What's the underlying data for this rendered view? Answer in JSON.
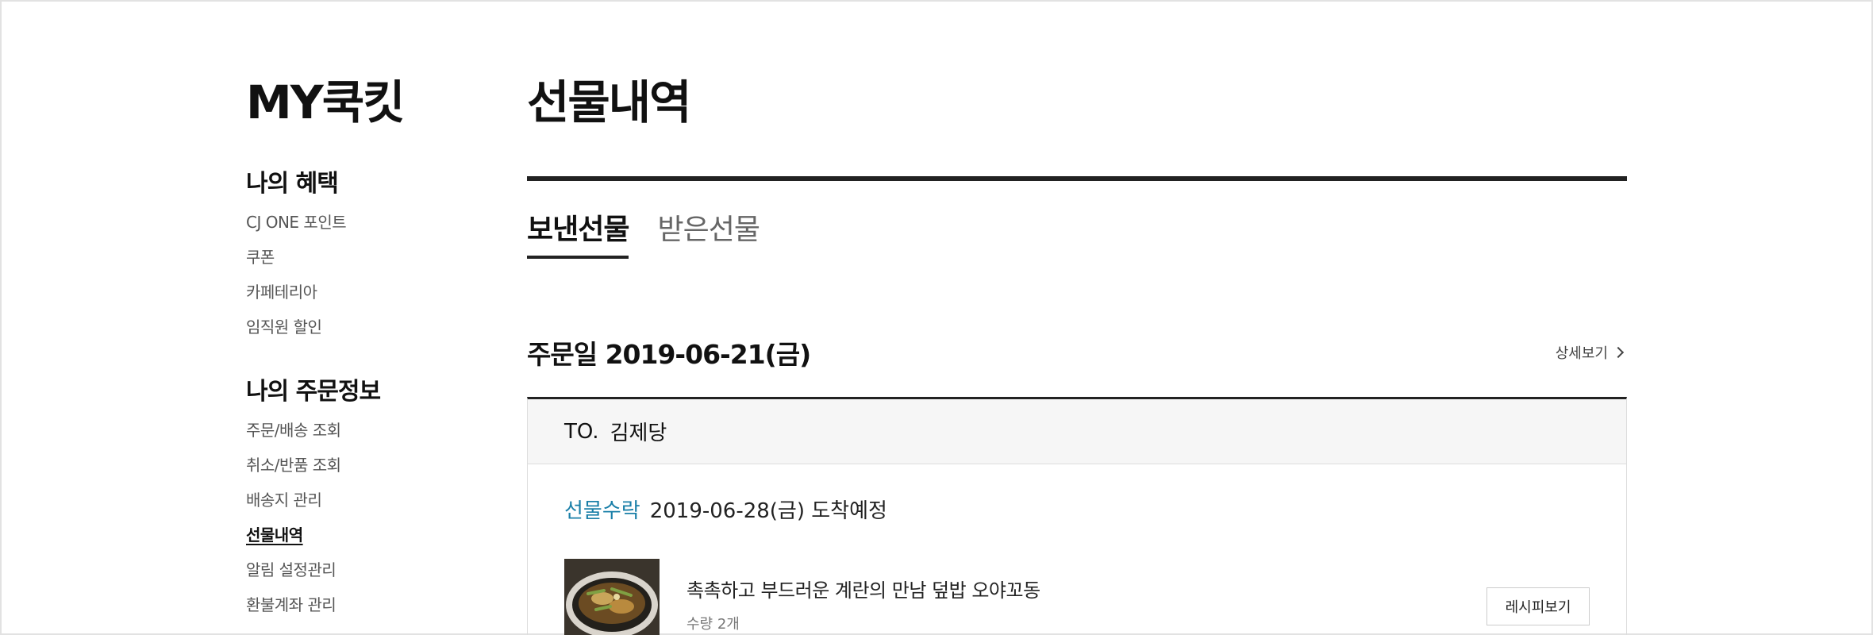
{
  "sidebar": {
    "title": "MY쿡킷",
    "groups": [
      {
        "title": "나의 혜택",
        "items": [
          "CJ ONE 포인트",
          "쿠폰",
          "카페테리아",
          "임직원 할인"
        ]
      },
      {
        "title": "나의 주문정보",
        "items": [
          "주문/배송 조회",
          "취소/반품 조회",
          "배송지 관리",
          "선물내역",
          "알림 설정관리",
          "환불계좌 관리"
        ],
        "active": "선물내역"
      }
    ]
  },
  "main": {
    "title": "선물내역",
    "tabs": [
      {
        "label": "보낸선물",
        "active": true
      },
      {
        "label": "받은선물",
        "active": false
      }
    ],
    "order": {
      "date": "주문일 2019-06-21(금)",
      "detail_label": "상세보기",
      "to_label": "TO.",
      "recipient": "김제당",
      "status": "선물수락",
      "arrival": "2019-06-28(금) 도착예정",
      "product": {
        "name": "촉촉하고 부드러운 계란의 만남 덮밥 오야꼬동",
        "qty": "수량 2개",
        "button": "레시피보기"
      }
    }
  },
  "colors": {
    "accent": "#1a7fa8",
    "rule": "#222222",
    "to_background": "#f6f6f6"
  }
}
